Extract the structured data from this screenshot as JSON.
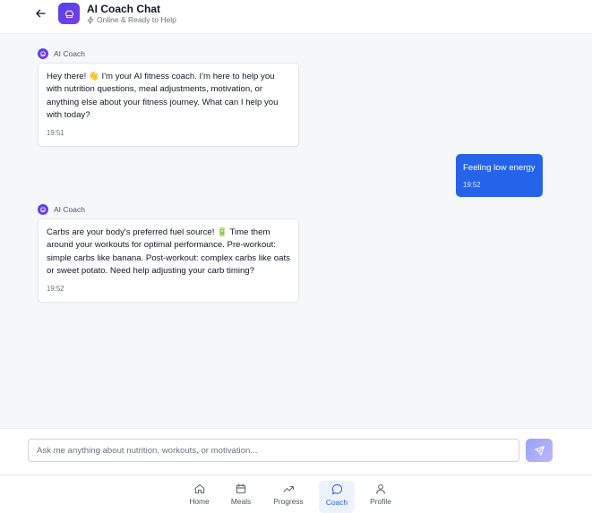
{
  "header": {
    "title": "AI Coach Chat",
    "status": "Online & Ready to Help"
  },
  "messages": [
    {
      "sender": "AI Coach",
      "text": "Hey there! 👋 I'm your AI fitness coach. I'm here to help you with nutrition questions, meal adjustments, motivation, or anything else about your fitness journey. What can I help you with today?",
      "time": "19:51"
    },
    {
      "sender": "user",
      "text": "Feeling low energy",
      "time": "19:52"
    },
    {
      "sender": "AI Coach",
      "text": "Carbs are your body's preferred fuel source! 🔋 Time them around your workouts for optimal performance. Pre-workout: simple carbs like banana. Post-workout: complex carbs like oats or sweet potato. Need help adjusting your carb timing?",
      "time": "19:52"
    }
  ],
  "input": {
    "placeholder": "Ask me anything about nutrition, workouts, or motivation...",
    "value": ""
  },
  "nav": {
    "items": [
      {
        "label": "Home",
        "icon": "home-icon"
      },
      {
        "label": "Meals",
        "icon": "calendar-icon"
      },
      {
        "label": "Progress",
        "icon": "trending-up-icon"
      },
      {
        "label": "Coach",
        "icon": "chat-icon",
        "active": true
      },
      {
        "label": "Profile",
        "icon": "user-icon"
      }
    ]
  },
  "colors": {
    "accent": "#2563eb",
    "brand_gradient_start": "#4f46e5",
    "brand_gradient_end": "#7c3aed",
    "background": "#f6f7f9"
  }
}
